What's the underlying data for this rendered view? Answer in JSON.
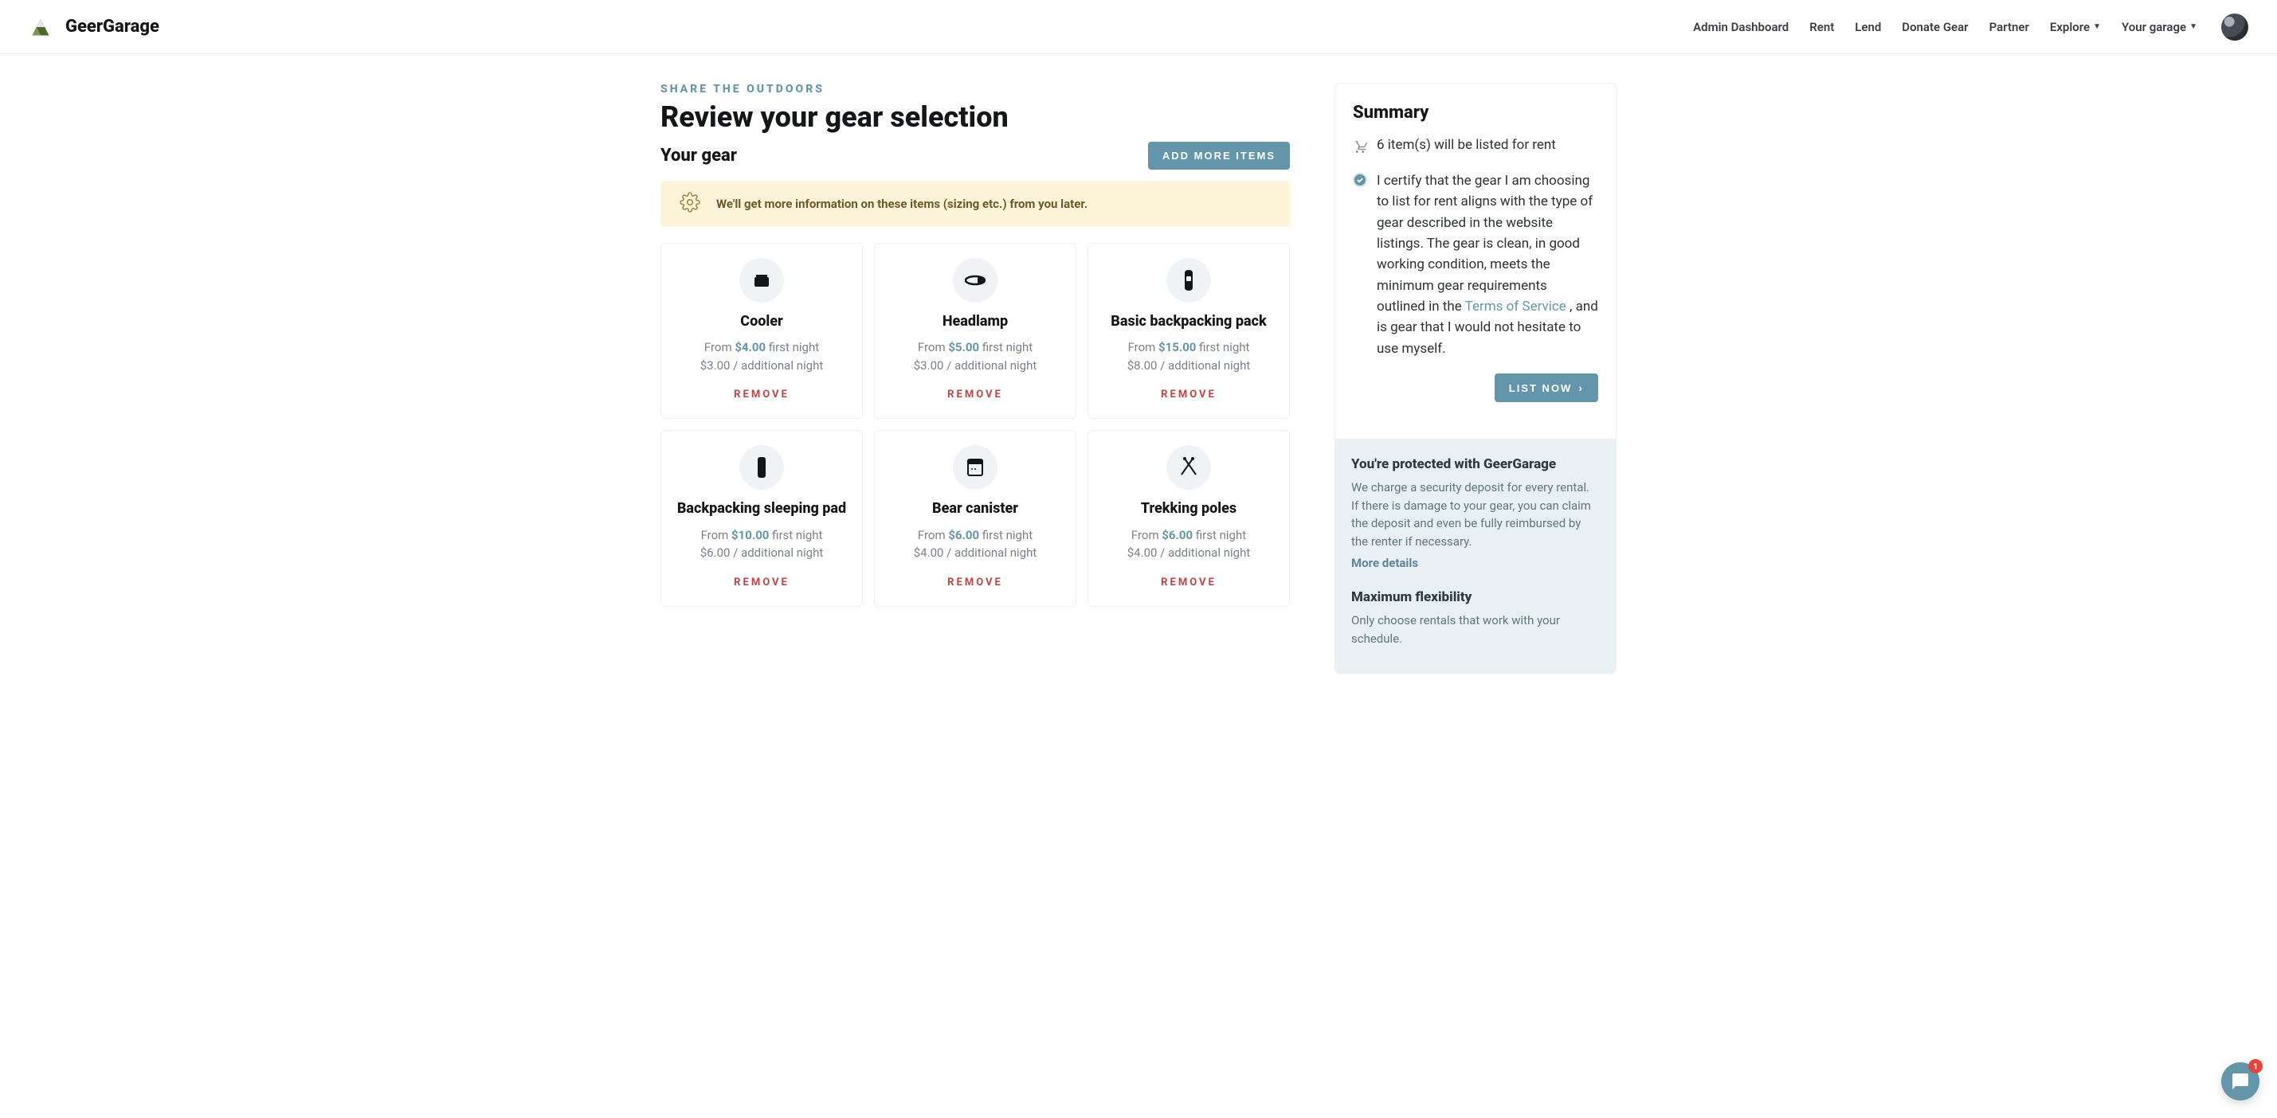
{
  "brand": "GeerGarage",
  "nav": [
    {
      "label": "Admin Dashboard",
      "has_caret": false
    },
    {
      "label": "Rent",
      "has_caret": false
    },
    {
      "label": "Lend",
      "has_caret": false
    },
    {
      "label": "Donate Gear",
      "has_caret": false
    },
    {
      "label": "Partner",
      "has_caret": false
    },
    {
      "label": "Explore",
      "has_caret": true
    },
    {
      "label": "Your garage",
      "has_caret": true
    }
  ],
  "eyebrow": "SHARE THE OUTDOORS",
  "page_title": "Review your gear selection",
  "your_gear_heading": "Your gear",
  "add_more_label": "ADD MORE ITEMS",
  "info_banner_text": "We'll get more information on these items (sizing etc.) from you later.",
  "gear_items": [
    {
      "icon": "cooler",
      "title": "Cooler",
      "first_price": "$4.00",
      "additional": "$3.00"
    },
    {
      "icon": "headlamp",
      "title": "Headlamp",
      "first_price": "$5.00",
      "additional": "$3.00"
    },
    {
      "icon": "backpack",
      "title": "Basic backpacking pack",
      "first_price": "$15.00",
      "additional": "$8.00"
    },
    {
      "icon": "pad",
      "title": "Backpacking sleeping pad",
      "first_price": "$10.00",
      "additional": "$6.00"
    },
    {
      "icon": "canister",
      "title": "Bear canister",
      "first_price": "$6.00",
      "additional": "$4.00"
    },
    {
      "icon": "poles",
      "title": "Trekking poles",
      "first_price": "$6.00",
      "additional": "$4.00"
    }
  ],
  "price_labels": {
    "from": "From ",
    "first_night": " first night",
    "additional_night": " / additional night"
  },
  "remove_label": "REMOVE",
  "summary": {
    "title": "Summary",
    "count_text": "6 item(s) will be listed for rent",
    "cert_text_pre": "I certify that the gear I am choosing to list for rent aligns with the type of gear described in the website listings. The gear is clean, in good working condition, meets the minimum gear requirements outlined in the ",
    "tos_text": "Terms of Service",
    "cert_text_post": " , and is gear that I would not hesitate to use myself.",
    "list_now_label": "LIST NOW",
    "protection": {
      "title": "You're protected with GeerGarage",
      "body": "We charge a security deposit for every rental. If there is damage to your gear, you can claim the deposit and even be fully reimbursed by the renter if necessary.",
      "more": "More details"
    },
    "flex": {
      "title": "Maximum flexibility",
      "body": "Only choose rentals that work with your schedule."
    }
  },
  "chat_badge": "1"
}
